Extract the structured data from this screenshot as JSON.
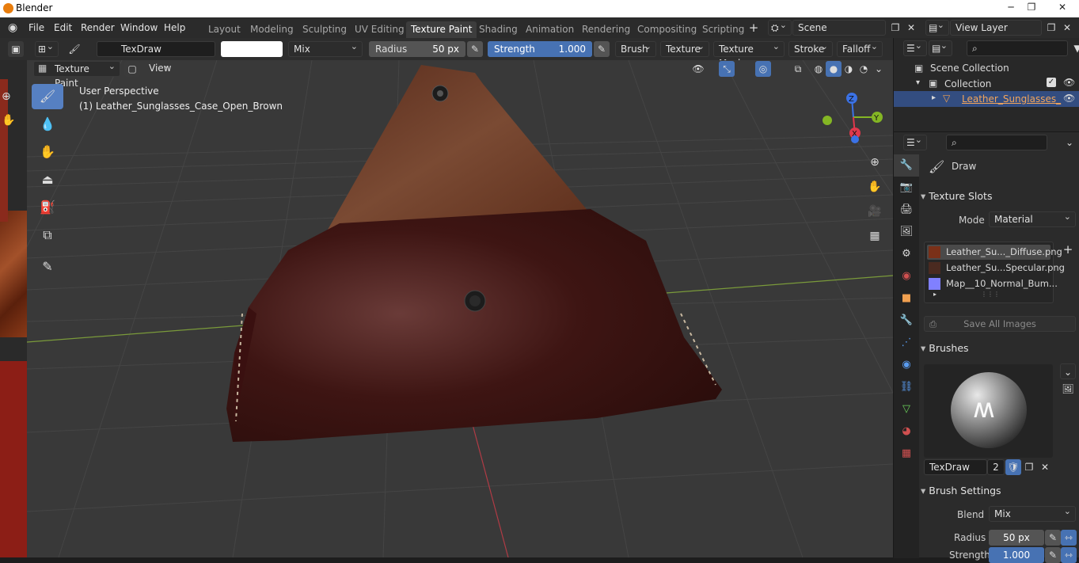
{
  "app": {
    "title": "Blender"
  },
  "menu": [
    "File",
    "Edit",
    "Render",
    "Window",
    "Help"
  ],
  "workspaces": [
    "Layout",
    "Modeling",
    "Sculpting",
    "UV Editing",
    "Texture Paint",
    "Shading",
    "Animation",
    "Rendering",
    "Compositing",
    "Scripting"
  ],
  "active_workspace": "Texture Paint",
  "scene": {
    "name": "Scene",
    "view_layer": "View Layer"
  },
  "tool_header": {
    "brush_name": "TexDraw",
    "blend": "Mix",
    "radius_label": "Radius",
    "radius_value": "50 px",
    "strength_label": "Strength",
    "strength_value": "1.000",
    "strength_fraction": 1.0,
    "menus": [
      "Brush",
      "Texture",
      "Texture Mask",
      "Stroke",
      "Falloff"
    ]
  },
  "viewport_header": {
    "mode": "Texture Paint",
    "view": "View"
  },
  "viewport": {
    "perspective": "User Perspective",
    "object_label": "(1) Leather_Sunglasses_Case_Open_Brown",
    "gizmo": {
      "x": "X",
      "y": "Y",
      "z": "Z"
    }
  },
  "outliner": {
    "scene_collection": "Scene Collection",
    "collection": "Collection",
    "object": "Leather_Sunglasses_"
  },
  "properties": {
    "tool_name": "Draw",
    "texture_slots": {
      "title": "Texture Slots",
      "mode_label": "Mode",
      "mode_value": "Material",
      "slots": [
        "Leather_Su..._Diffuse.png",
        "Leather_Su...Specular.png",
        "Map__10_Normal_Bum..."
      ],
      "save_all": "Save All Images"
    },
    "brushes": {
      "title": "Brushes",
      "brush_name": "TexDraw",
      "users": "2"
    },
    "brush_settings": {
      "title": "Brush Settings",
      "blend_label": "Blend",
      "blend_value": "Mix",
      "radius_label": "Radius",
      "radius_value": "50 px",
      "strength_label": "Strength",
      "strength_value": "1.000",
      "strength_fraction": 1.0
    }
  },
  "colors": {
    "accent": "#4772b3",
    "active_tool": "#5680c2",
    "header": "#2b2b2b",
    "viewport_bg": "#393939",
    "leather_dark": "#3a1210",
    "leather_light": "#6b3b28",
    "gizmo_x": "#e0384c",
    "gizmo_y": "#84b624",
    "gizmo_z": "#3b72e6"
  }
}
